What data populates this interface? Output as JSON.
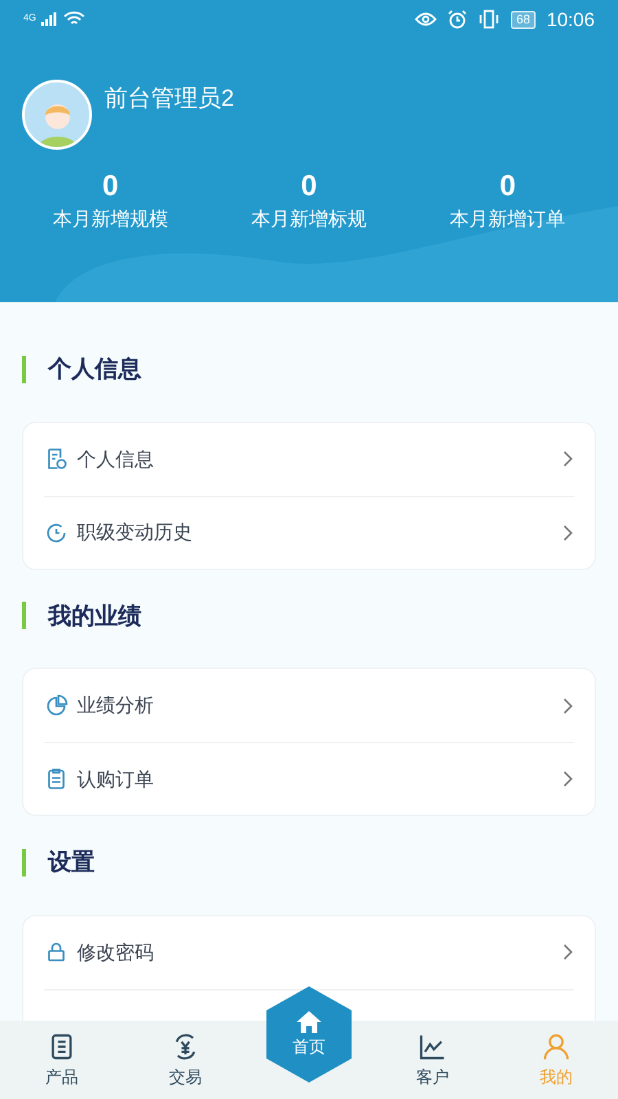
{
  "status_bar": {
    "network": "4G",
    "battery": "68",
    "time": "10:06"
  },
  "profile": {
    "name": "前台管理员2"
  },
  "stats": [
    {
      "value": "0",
      "label": "本月新增规模"
    },
    {
      "value": "0",
      "label": "本月新增标规"
    },
    {
      "value": "0",
      "label": "本月新增订单"
    }
  ],
  "sections": [
    {
      "title": "个人信息",
      "items": [
        {
          "label": "个人信息",
          "kind": "profile"
        },
        {
          "label": "职级变动历史",
          "kind": "history"
        }
      ]
    },
    {
      "title": "我的业绩",
      "items": [
        {
          "label": "业绩分析",
          "kind": "chart"
        },
        {
          "label": "认购订单",
          "kind": "clipboard"
        }
      ]
    },
    {
      "title": "设置",
      "items": [
        {
          "label": "修改密码",
          "kind": "lock"
        }
      ]
    }
  ],
  "tabs": [
    {
      "label": "产品",
      "kind": "product",
      "selected": false
    },
    {
      "label": "交易",
      "kind": "trade",
      "selected": false
    },
    {
      "label": "首页",
      "kind": "home",
      "selected": false
    },
    {
      "label": "客户",
      "kind": "customer",
      "selected": false
    },
    {
      "label": "我的",
      "kind": "me",
      "selected": true
    }
  ]
}
